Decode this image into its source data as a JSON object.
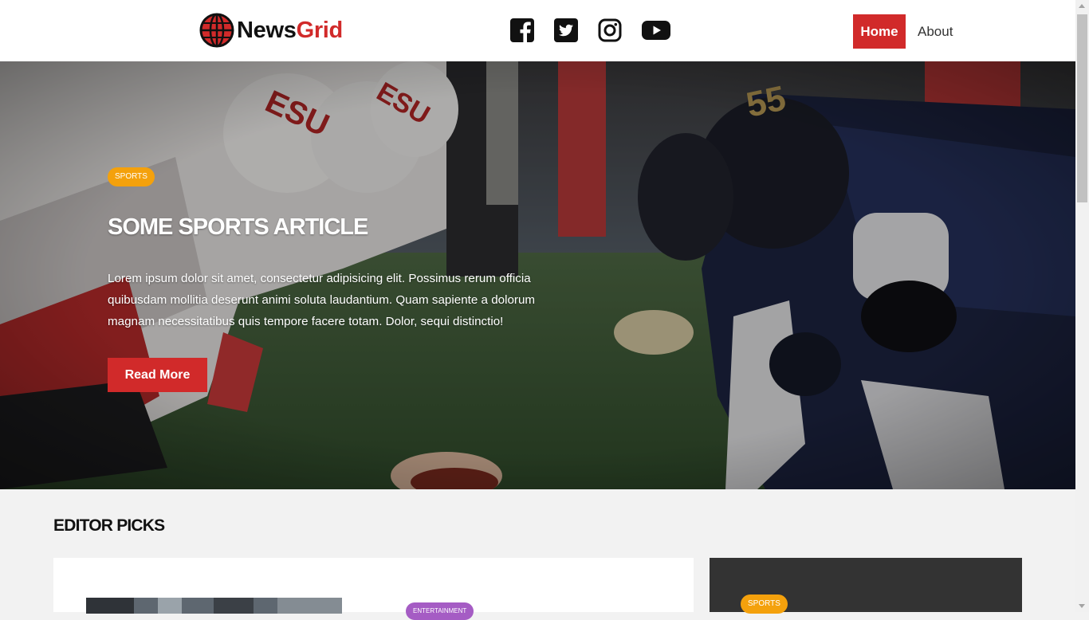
{
  "brand": {
    "name_part1": "News",
    "name_part2": "Grid",
    "accent": "#d12a2a"
  },
  "social": [
    {
      "icon": "facebook-icon"
    },
    {
      "icon": "twitter-icon"
    },
    {
      "icon": "instagram-icon"
    },
    {
      "icon": "youtube-icon"
    }
  ],
  "nav": {
    "home": "Home",
    "about": "About"
  },
  "hero": {
    "category": "SPORTS",
    "title": "SOME SPORTS ARTICLE",
    "text": "Lorem ipsum dolor sit amet, consectetur adipisicing elit. Possimus rerum officia quibusdam mollitia deserunt animi soluta laudantium. Quam sapiente a dolorum magnam necessitatibus quis tempore facere totam. Dolor, sequi distinctio!",
    "button": "Read More"
  },
  "editor_picks": {
    "title": "EDITOR PICKS",
    "card1_category": "ENTERTAINMENT",
    "card2_category": "SPORTS"
  },
  "colors": {
    "sports": "#f4a10c",
    "entertainment": "#a55cc4",
    "dark_card": "#333333"
  }
}
